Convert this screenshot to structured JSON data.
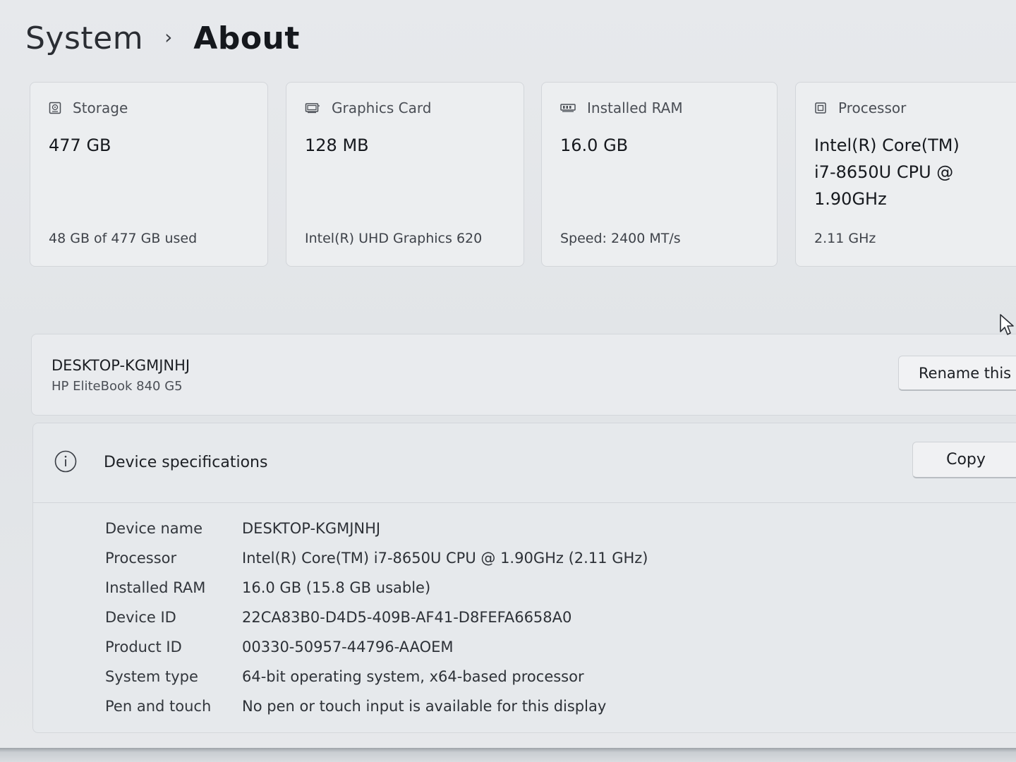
{
  "breadcrumb": {
    "parent": "System",
    "separator": "›",
    "current": "About"
  },
  "cards": [
    {
      "icon": "storage-icon",
      "label": "Storage",
      "value": "477 GB",
      "sub": "48 GB of 477 GB used"
    },
    {
      "icon": "graphics-card-icon",
      "label": "Graphics Card",
      "value": "128 MB",
      "sub": "Intel(R) UHD Graphics 620"
    },
    {
      "icon": "ram-icon",
      "label": "Installed RAM",
      "value": "16.0 GB",
      "sub": "Speed: 2400 MT/s"
    },
    {
      "icon": "processor-icon",
      "label": "Processor",
      "value": "Intel(R) Core(TM)\ni7-8650U CPU @\n1.90GHz",
      "sub": "2.11 GHz"
    }
  ],
  "device": {
    "name": "DESKTOP-KGMJNHJ",
    "model": "HP EliteBook 840 G5",
    "rename_label": "Rename this P"
  },
  "specs": {
    "title": "Device specifications",
    "copy_label": "Copy",
    "rows": [
      {
        "key": "Device name",
        "value": "DESKTOP-KGMJNHJ"
      },
      {
        "key": "Processor",
        "value": "Intel(R) Core(TM) i7-8650U CPU @ 1.90GHz (2.11 GHz)"
      },
      {
        "key": "Installed RAM",
        "value": "16.0 GB (15.8 GB usable)"
      },
      {
        "key": "Device ID",
        "value": "22CA83B0-D4D5-409B-AF41-D8FEFA6658A0"
      },
      {
        "key": "Product ID",
        "value": "00330-50957-44796-AAOEM"
      },
      {
        "key": "System type",
        "value": "64-bit operating system, x64-based processor"
      },
      {
        "key": "Pen and touch",
        "value": "No pen or touch input is available for this display"
      }
    ]
  }
}
